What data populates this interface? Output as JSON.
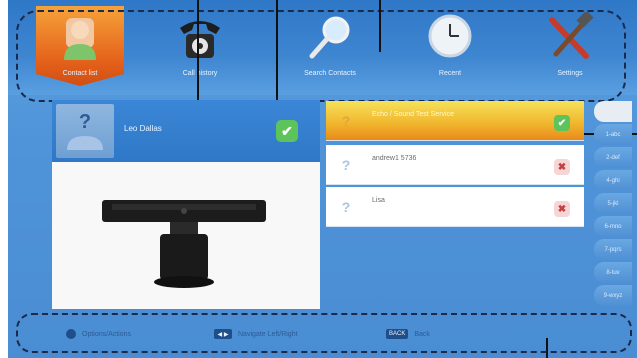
{
  "menu": {
    "items": [
      {
        "label": "Contact list",
        "icon": "contact-icon",
        "active": true
      },
      {
        "label": "Call history",
        "icon": "telephone-icon",
        "active": false
      },
      {
        "label": "Search Contacts",
        "icon": "magnifier-icon",
        "active": false
      },
      {
        "label": "Recent",
        "icon": "clock-icon",
        "active": false
      },
      {
        "label": "Settings",
        "icon": "tools-icon",
        "active": false
      }
    ]
  },
  "contact": {
    "name": "Leo Dallas",
    "status_icon": "check-icon"
  },
  "list": {
    "rows": [
      {
        "label": "Echo / Sound Test Service",
        "status": "ok",
        "selected": true
      },
      {
        "label": "andrew1 5736",
        "status": "x",
        "selected": false
      },
      {
        "label": "Lisa",
        "status": "x",
        "selected": false
      }
    ]
  },
  "alpha_index": [
    "",
    "1-abc",
    "2-def",
    "4-ghi",
    "5-jkl",
    "6-mno",
    "7-pqrs",
    "8-tuv",
    "9-wxyz"
  ],
  "hints": {
    "options_label": "Options/Actions",
    "navigate_label": "Navigate Left/Right",
    "back_label": "Back",
    "navigate_key": "◀ ▶",
    "back_key": "BACK"
  },
  "colors": {
    "accent_orange": "#e4611b",
    "selected_row": "#f0b42c",
    "background_blue": "#4f93d8",
    "ok_green": "#5cc45a"
  }
}
